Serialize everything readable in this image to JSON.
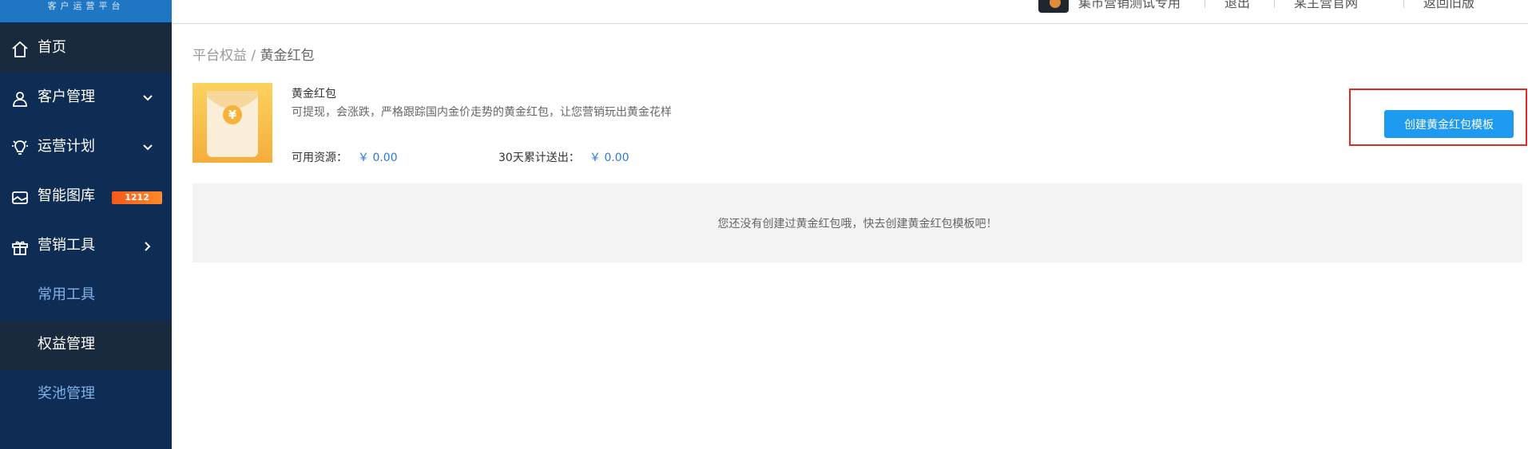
{
  "sidebar": {
    "brand": "客户运营平台",
    "items": [
      {
        "label": "首页"
      },
      {
        "label": "客户管理"
      },
      {
        "label": "运营计划"
      },
      {
        "label": "智能图库",
        "badge": "1212"
      },
      {
        "label": "营销工具"
      },
      {
        "label": "常用工具"
      },
      {
        "label": "权益管理"
      },
      {
        "label": "奖池管理"
      }
    ]
  },
  "topbar": {
    "items": [
      "集市营销测试专用",
      "退出",
      "某主营官网",
      "返回旧版"
    ]
  },
  "breadcrumb": {
    "parent": "平台权益",
    "separator": " / ",
    "current": "黄金红包"
  },
  "product": {
    "title": "黄金红包",
    "description": "可提现，会涨跌，严格跟踪国内金价走势的黄金红包，让您营销玩出黄金花样",
    "available_label": "可用资源：",
    "available_value": "￥ 0.00",
    "sent_label": "30天累计送出：",
    "sent_value": "￥ 0.00",
    "icon_symbol": "¥"
  },
  "actions": {
    "create_label": "创建黄金红包模板"
  },
  "empty_state": {
    "message": "您还没有创建过黄金红包哦，快去创建黄金红包模板吧！"
  },
  "colors": {
    "sidebar_bg": "#0f2d54",
    "accent": "#1e9af0",
    "highlight": "#e02a2a",
    "badge": "#f86a1b",
    "money": "#2a7bd0"
  }
}
